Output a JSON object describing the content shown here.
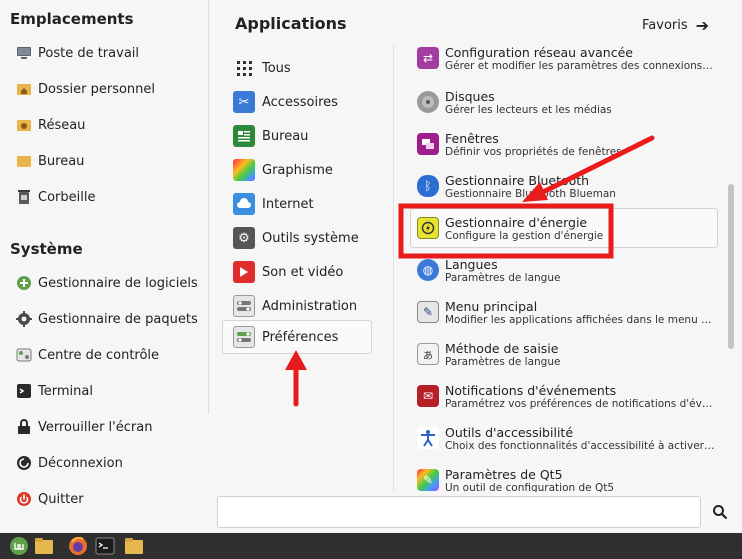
{
  "left": {
    "places_title": "Emplacements",
    "places": [
      {
        "label": "Poste de travail",
        "icon": "computer-icon"
      },
      {
        "label": "Dossier personnel",
        "icon": "home-folder-icon"
      },
      {
        "label": "Réseau",
        "icon": "network-folder-icon"
      },
      {
        "label": "Bureau",
        "icon": "desktop-folder-icon"
      },
      {
        "label": "Corbeille",
        "icon": "trash-icon"
      }
    ],
    "system_title": "Système",
    "system": [
      {
        "label": "Gestionnaire de logiciels",
        "icon": "software-manager-icon"
      },
      {
        "label": "Gestionnaire de paquets",
        "icon": "package-manager-icon"
      },
      {
        "label": "Centre de contrôle",
        "icon": "control-center-icon"
      },
      {
        "label": "Terminal",
        "icon": "terminal-icon"
      },
      {
        "label": "Verrouiller l'écran",
        "icon": "lock-icon"
      },
      {
        "label": "Déconnexion",
        "icon": "logout-icon"
      },
      {
        "label": "Quitter",
        "icon": "power-icon"
      }
    ]
  },
  "categories": {
    "title": "Applications",
    "items": [
      {
        "label": "Tous",
        "icon": "grid-icon"
      },
      {
        "label": "Accessoires",
        "icon": "scissors-icon"
      },
      {
        "label": "Bureau",
        "icon": "office-icon"
      },
      {
        "label": "Graphisme",
        "icon": "graphics-icon"
      },
      {
        "label": "Internet",
        "icon": "cloud-icon"
      },
      {
        "label": "Outils système",
        "icon": "gear-icon"
      },
      {
        "label": "Son et vidéo",
        "icon": "play-icon"
      },
      {
        "label": "Administration",
        "icon": "toggles-icon"
      },
      {
        "label": "Préférences",
        "icon": "preferences-toggle-icon",
        "selected": true
      }
    ]
  },
  "favorites": {
    "label": "Favoris",
    "icon": "arrow-right-icon"
  },
  "apps": [
    {
      "name": "Configuration réseau avancée",
      "desc": "Gérer et modifier les paramètres des connexions …",
      "icon": "network-config-icon",
      "color": "#a23ca0"
    },
    {
      "name": "Disques",
      "desc": "Gérer les lecteurs et les médias",
      "icon": "disk-icon",
      "color": "#8a8a8a"
    },
    {
      "name": "Fenêtres",
      "desc": "Définir vos propriétés de fenêtres",
      "icon": "windows-icon",
      "color": "#a01e8c"
    },
    {
      "name": "Gestionnaire Bluetooth",
      "desc": "Gestionnaire Bluetooth Blueman",
      "icon": "bluetooth-icon",
      "color": "#2a6fd1"
    },
    {
      "name": "Gestionnaire d'énergie",
      "desc": "Configure la gestion d'énergie",
      "icon": "power-manager-icon",
      "color": "#e8e230",
      "highlighted": true
    },
    {
      "name": "Langues",
      "desc": "Paramètres de langue",
      "icon": "language-icon",
      "color": "#3a7ad6"
    },
    {
      "name": "Menu principal",
      "desc": "Modifier les applications affichées dans le menu …",
      "icon": "menu-editor-icon",
      "color": "#5f7a9a"
    },
    {
      "name": "Méthode de saisie",
      "desc": "Paramètres de langue",
      "icon": "input-method-icon",
      "color": "#cfcfcf"
    },
    {
      "name": "Notifications d'événements",
      "desc": "Paramétrez vos préférences de notifications d'évé…",
      "icon": "notifications-icon",
      "color": "#b61e28"
    },
    {
      "name": "Outils d'accessibilité",
      "desc": "Choix des fonctionnalités d'accessibilité à activer …",
      "icon": "accessibility-icon",
      "color": "#2a62c8"
    },
    {
      "name": "Paramètres de Qt5",
      "desc": "Un outil de configuration de Qt5",
      "icon": "qt5-icon",
      "color": "#d04a9a"
    }
  ],
  "search": {
    "placeholder": ""
  },
  "taskbar": [
    {
      "name": "mint-menu-icon",
      "color": "#5ea14a"
    },
    {
      "name": "files-icon",
      "color": "#e6b850"
    },
    {
      "name": "firefox-icon",
      "color": "#e8702a"
    },
    {
      "name": "terminal-icon",
      "color": "#1c1c1c"
    },
    {
      "name": "folder-icon",
      "color": "#e6b850"
    }
  ],
  "annotation_color": "#e81c1c"
}
